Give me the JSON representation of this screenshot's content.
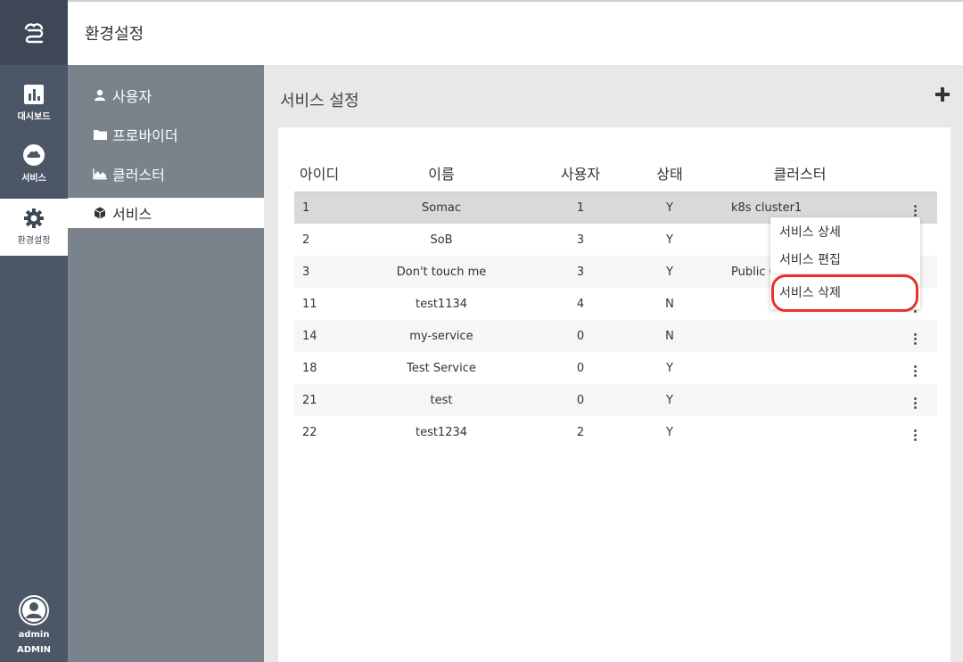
{
  "header": {
    "title": "환경설정"
  },
  "rail": {
    "items": [
      {
        "label": "대시보드",
        "icon": "bar-chart-icon"
      },
      {
        "label": "서비스",
        "icon": "cloud-icon"
      },
      {
        "label": "환경설정",
        "icon": "gear-icon"
      }
    ],
    "user": {
      "name": "admin",
      "role": "ADMIN"
    }
  },
  "subnav": {
    "items": [
      {
        "label": "사용자",
        "icon": "user-icon"
      },
      {
        "label": "프로바이더",
        "icon": "folder-icon"
      },
      {
        "label": "클러스터",
        "icon": "area-chart-icon"
      },
      {
        "label": "서비스",
        "icon": "cube-icon"
      }
    ]
  },
  "main": {
    "title": "서비스 설정",
    "table": {
      "headers": [
        "아이디",
        "이름",
        "사용자",
        "상태",
        "클러스터"
      ],
      "rows": [
        {
          "id": "1",
          "name": "Somac",
          "users": "1",
          "status": "Y",
          "cluster": "k8s cluster1"
        },
        {
          "id": "2",
          "name": "SoB",
          "users": "3",
          "status": "Y",
          "cluster": ""
        },
        {
          "id": "3",
          "name": "Don't touch me",
          "users": "3",
          "status": "Y",
          "cluster": "Public Clu"
        },
        {
          "id": "11",
          "name": "test1134",
          "users": "4",
          "status": "N",
          "cluster": ""
        },
        {
          "id": "14",
          "name": "my-service",
          "users": "0",
          "status": "N",
          "cluster": ""
        },
        {
          "id": "18",
          "name": "Test Service",
          "users": "0",
          "status": "Y",
          "cluster": ""
        },
        {
          "id": "21",
          "name": "test",
          "users": "0",
          "status": "Y",
          "cluster": ""
        },
        {
          "id": "22",
          "name": "test1234",
          "users": "2",
          "status": "Y",
          "cluster": ""
        }
      ]
    }
  },
  "context_menu": {
    "items": [
      "서비스 상세",
      "서비스 편집",
      "서비스 삭제"
    ]
  },
  "colors": {
    "rail_bg": "#4b5667",
    "subnav_bg": "#7a828c",
    "highlight": "#e8322e"
  }
}
